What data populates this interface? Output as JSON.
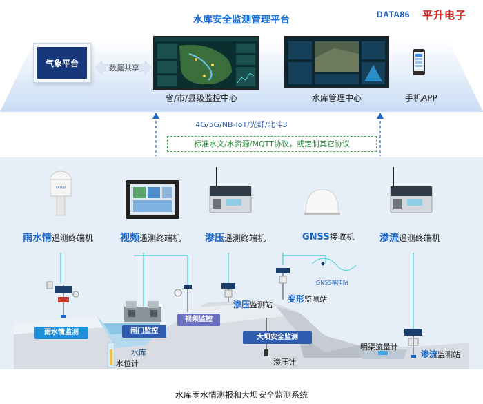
{
  "header": {
    "title": "水库安全监测管理平台",
    "brand_en": "DATA86",
    "brand_cn": "平升电子"
  },
  "platform": {
    "meteo_label": "气象平台",
    "share_label": "数据共享",
    "center1_label": "省/市/县级监控中心",
    "center2_label": "水库管理中心",
    "app_label": "手机APP"
  },
  "network": {
    "channels": "4G/5G/NB-IoT/光纤/北斗3",
    "protocols": "标准水文/水资源/MQTT协议，或定制其它协议"
  },
  "devices": [
    {
      "highlight": "雨水情",
      "rest": "遥测终端机"
    },
    {
      "highlight": "视频",
      "rest": "遥测终端机"
    },
    {
      "highlight": "渗压",
      "rest": "遥测终端机"
    },
    {
      "highlight": "GNSS",
      "rest": "接收机"
    },
    {
      "highlight": "渗流",
      "rest": "遥测终端机"
    }
  ],
  "device_brand": "DATA86",
  "scene": {
    "tag_rain": "雨水情监测",
    "tag_gate": "闸门监控",
    "tag_video": "视频监控",
    "tag_dam": "大坝安全监测",
    "reservoir": "水库",
    "water_gauge": "水位计",
    "seepage_station_hl": "渗压",
    "seepage_station_rest": "监测站",
    "deform_station_hl": "变形",
    "deform_station_rest": "监测站",
    "gnss_base": "GNSS基准站",
    "piezometer": "渗压计",
    "channel_meter": "明渠流量计",
    "flow_station_hl": "渗流",
    "flow_station_rest": "监测站"
  },
  "caption": "水库雨水情测报和大坝安全监测系统",
  "colors": {
    "accent": "#1a66c9",
    "tag_blue": "#1f8fd8",
    "tag_navy": "#2f5cae",
    "tag_purple": "#6a6fbf",
    "cyan_link": "#3fd0d8",
    "protocol_green": "#36b04a"
  }
}
